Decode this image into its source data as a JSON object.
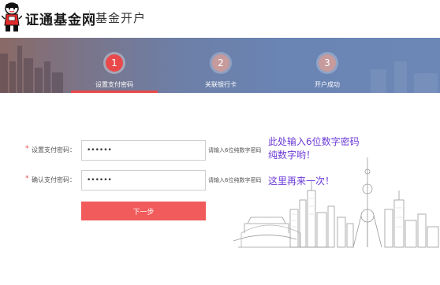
{
  "header": {
    "logo_text": "证通基金网",
    "section_title": "基金开户"
  },
  "steps": [
    {
      "number": "1",
      "label": "设置支付密码",
      "active": true
    },
    {
      "number": "2",
      "label": "关联银行卡",
      "active": false
    },
    {
      "number": "3",
      "label": "开户成功",
      "active": false
    }
  ],
  "form": {
    "required_mark": "*",
    "password": {
      "label": "设置支付密码：",
      "value": "••••••",
      "hint": "请输入6位纯数字密码"
    },
    "confirm": {
      "label": "确认支付密码：",
      "value": "••••••",
      "hint": "请输入6位纯数字密码"
    },
    "next_button": "下一步"
  },
  "annotations": {
    "line1": "此处输入6位数字密码",
    "line2": "纯数字哟！",
    "line3": "这里再来一次！"
  },
  "colors": {
    "accent": "#e9494a",
    "button": "#f15b5b",
    "annotation": "#6b3bd6",
    "banner": "#6a84b4"
  },
  "icons": {
    "logo": "mascot-logo",
    "decoration": "city-skyline-illustration"
  }
}
